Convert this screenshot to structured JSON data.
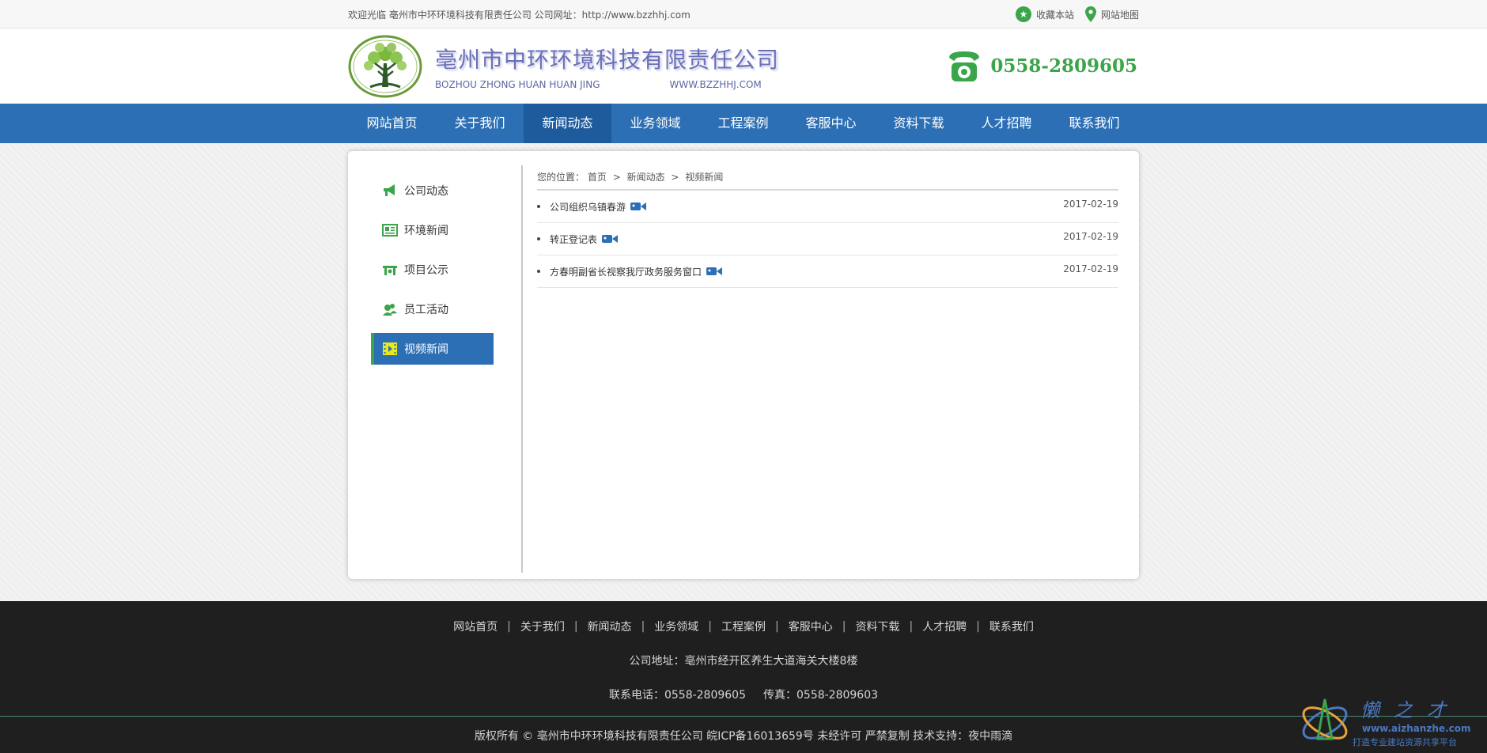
{
  "topbar": {
    "welcome": "欢迎光临 亳州市中环环境科技有限责任公司 公司网址：http://www.bzzhhj.com",
    "favorite": "收藏本站",
    "sitemap": "网站地图"
  },
  "header": {
    "company_cn": "亳州市中环环境科技有限责任公司",
    "company_en": "BOZHOU ZHONG HUAN HUAN JING",
    "website": "WWW.BZZHHJ.COM",
    "phone": "0558-2809605"
  },
  "nav": {
    "items": [
      {
        "label": "网站首页"
      },
      {
        "label": "关于我们"
      },
      {
        "label": "新闻动态"
      },
      {
        "label": "业务领域"
      },
      {
        "label": "工程案例"
      },
      {
        "label": "客服中心"
      },
      {
        "label": "资料下载"
      },
      {
        "label": "人才招聘"
      },
      {
        "label": "联系我们"
      }
    ],
    "active": "新闻动态"
  },
  "sidebar": {
    "items": [
      {
        "label": "公司动态",
        "icon": "megaphone-icon"
      },
      {
        "label": "环境新闻",
        "icon": "newspaper-icon"
      },
      {
        "label": "项目公示",
        "icon": "tools-icon"
      },
      {
        "label": "员工活动",
        "icon": "people-icon"
      },
      {
        "label": "视频新闻",
        "icon": "film-icon"
      }
    ],
    "active": "视频新闻"
  },
  "breadcrumb": {
    "prefix": "您的位置：",
    "items": [
      "首页",
      "新闻动态",
      "视频新闻"
    ],
    "separator": ">"
  },
  "news": [
    {
      "title": "公司组织乌镇春游",
      "date": "2017-02-19"
    },
    {
      "title": "转正登记表",
      "date": "2017-02-19"
    },
    {
      "title": "方春明副省长视察我厅政务服务窗口",
      "date": "2017-02-19"
    }
  ],
  "footer": {
    "links": [
      "网站首页",
      "关于我们",
      "新闻动态",
      "业务领域",
      "工程案例",
      "客服中心",
      "资料下载",
      "人才招聘",
      "联系我们"
    ],
    "address": "公司地址：亳州市经开区养生大道海关大楼8楼",
    "phone": "联系电话：0558-2809605",
    "fax": "传真：0558-2809603",
    "copyright": "版权所有 ©   亳州市中环环境科技有限责任公司   皖ICP备16013659号   未经许可 严禁复制   技术支持：夜中雨滴"
  },
  "watermark": {
    "title": "懒之才",
    "url": "www.aizhanzhe.com",
    "slogan": "打造专业建站资源共享平台"
  },
  "colors": {
    "nav_blue": "#2d6fb4",
    "nav_active": "#1d5b9c",
    "green": "#3aa54a",
    "footer_bg": "#1f1f1f"
  }
}
